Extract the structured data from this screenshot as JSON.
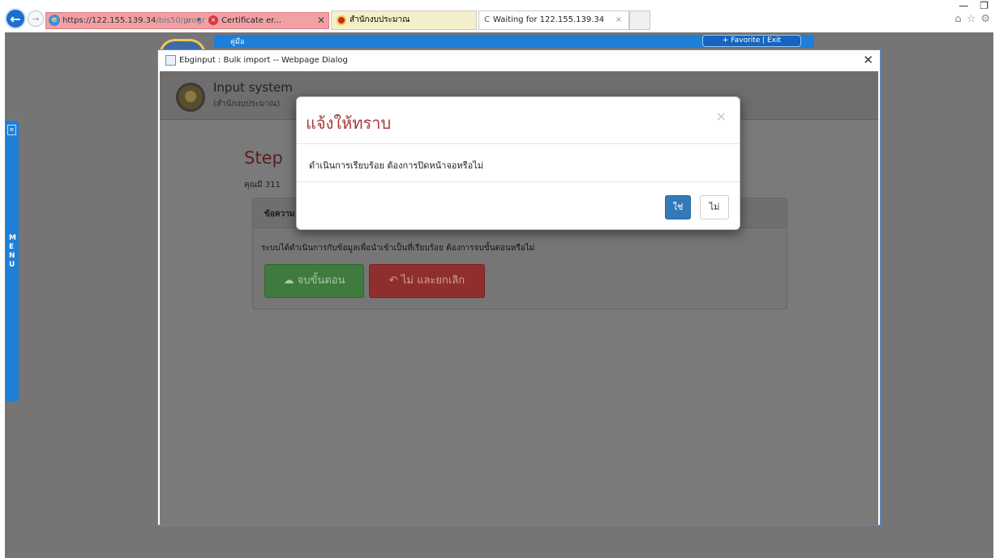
{
  "browser": {
    "url_host": "https://122.155.139.34",
    "url_path": "/bis50/progr",
    "cert_error_label": "Certificate er...",
    "tab2_label": "สำนักงบประมาณ",
    "tab3_label": "Waiting for 122.155.139.34",
    "icons": {
      "back": "back-arrow-icon",
      "forward": "forward-arrow-icon",
      "search": "search-icon",
      "cert": "certificate-error-icon",
      "home": "home-icon",
      "favorites": "favorites-star-icon",
      "settings": "gear-icon"
    }
  },
  "underlying": {
    "guide_label": "คู่มือ",
    "fav_exit_label": "+ Favorite | Exit",
    "menu_letters": [
      "M",
      "E",
      "N",
      "U"
    ]
  },
  "dialog": {
    "title": "Ebginput : Bulk import -- Webpage Dialog",
    "system_title": "Input system",
    "system_subtitle": "(สำนักงบประมาณ)",
    "step_title": "Step",
    "step_note": "คุณมี 311",
    "panel_heading": "ข้อความ",
    "panel_text": "ระบบได้ดำเนินการกับข้อมูลเพื่อนำเข้าเป็นที่เรียบร้อย ต้องการจบขั้นตอนหรือไม่",
    "finish_button": "จบขั้นตอน",
    "cancel_button": "ไม่ และยกเลิก"
  },
  "modal": {
    "title": "แจ้งให้ทราบ",
    "message": "ดำเนินการเรียบร้อย ต้องการปิดหน้าจอหรือไม่",
    "yes_label": "ใช่",
    "no_label": "ไม่"
  },
  "colors": {
    "accent": "#337ab7",
    "modal_title": "#a73838",
    "finish_green": "#3f7a3f",
    "cancel_red": "#8f2f2d",
    "overlay": "#757575"
  }
}
